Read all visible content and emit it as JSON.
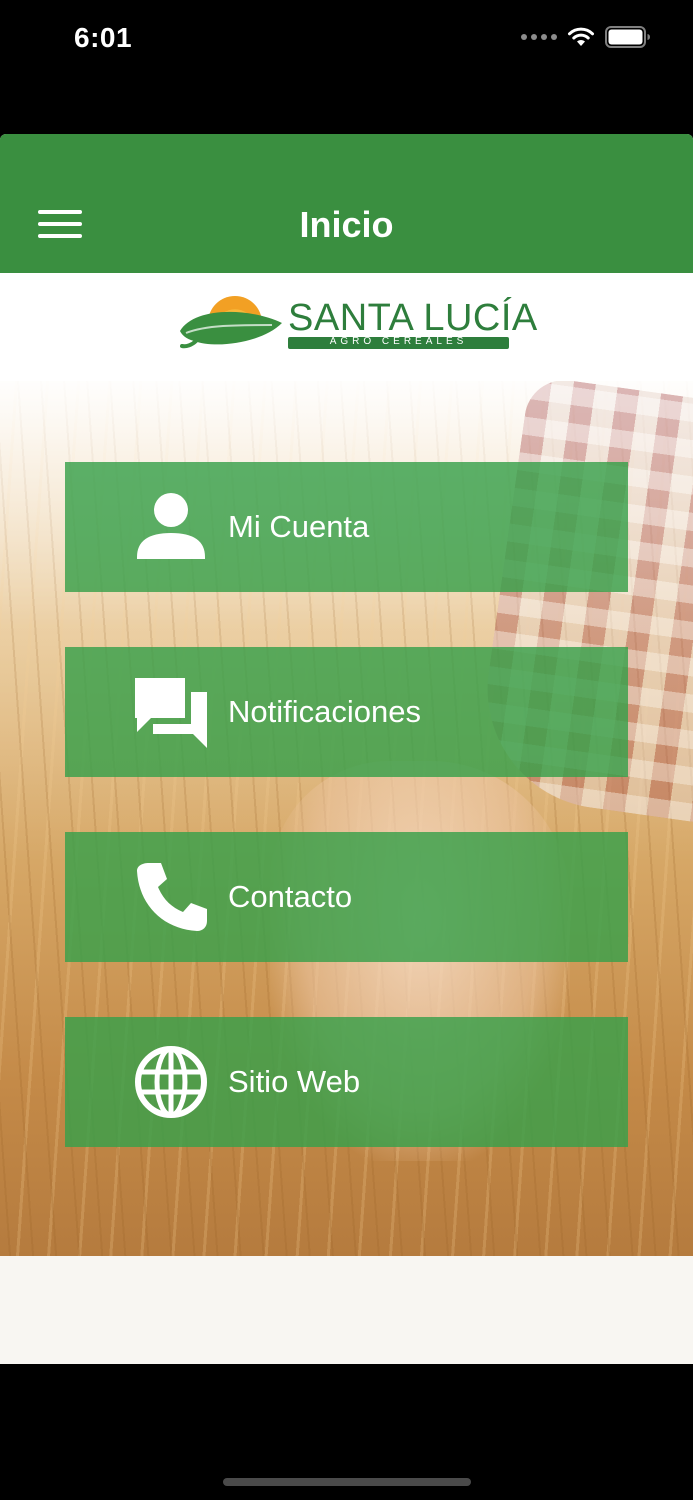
{
  "status_bar": {
    "time": "6:01"
  },
  "nav": {
    "title": "Inicio"
  },
  "logo": {
    "title": "SANTA LUCÍA",
    "subtitle": "AGRO CEREALES"
  },
  "menu": {
    "items": [
      {
        "label": "Mi Cuenta",
        "icon": "person-icon"
      },
      {
        "label": "Notificaciones",
        "icon": "chat-icon"
      },
      {
        "label": "Contacto",
        "icon": "phone-icon"
      },
      {
        "label": "Sitio Web",
        "icon": "globe-icon"
      }
    ]
  },
  "colors": {
    "primary": "#3a8f40",
    "button": "#38a04a",
    "logo_green": "#2e7e3c",
    "logo_sun": "#f2a024"
  }
}
